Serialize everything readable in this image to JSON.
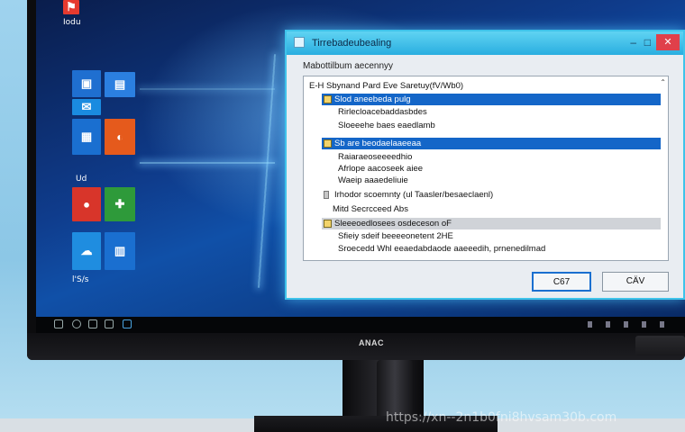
{
  "start_menu": {
    "top_label": "Iodu",
    "group_label": "Ud",
    "bottom_label": "l'S/s"
  },
  "dialog": {
    "title": "Tirrebadeubealing",
    "menu_text": "Mabottilbum aecennyy",
    "title_buttons": {
      "minimize": "‒",
      "maximize": "□",
      "close": "✕"
    },
    "rows": [
      {
        "label": "E-H  Sbynand Pard Eve  Saretuy(fV/Wb0)",
        "style": "plain"
      },
      {
        "label": "Slod aneebeda  pulg",
        "style": "blue",
        "checkbox": "yellow"
      },
      {
        "label": "Rirlecloacebaddasbdes",
        "style": "plain"
      },
      {
        "label": "Sloeeehe baes eaedlamb",
        "style": "plain"
      },
      {
        "label": "Sb are beodaelaaeeaa",
        "style": "blue",
        "checkbox": "yellow"
      },
      {
        "label": "Raiaraeoseeeedhio",
        "style": "plain"
      },
      {
        "label": "Afrlope aacoseek aiee",
        "style": "plain"
      },
      {
        "label": "Waeip aaaedeliuie",
        "style": "plain"
      },
      {
        "label": "Irhodor scoemnty  (ul Taasler/besaeclaenl)",
        "style": "plain",
        "checkbox": "none-small"
      },
      {
        "label": "Mitd  Secrcceed Abs",
        "style": "plain"
      },
      {
        "label": "Sleeeoedlosees osdeceson oF",
        "style": "gray",
        "checkbox": "yellow"
      },
      {
        "label": "Sfieiy  sdeif beeeeonetent 2HE",
        "style": "plain"
      },
      {
        "label": "Sroecedd Whl eeaedabdaode aaeeedih,  prnenedilmad",
        "style": "plain"
      }
    ],
    "ok_label": "C67",
    "cancel_label": "CÄV"
  },
  "monitor": {
    "brand": "ANAC"
  },
  "watermark": "https://xn--2n1b0fni8hvsam30b.com"
}
